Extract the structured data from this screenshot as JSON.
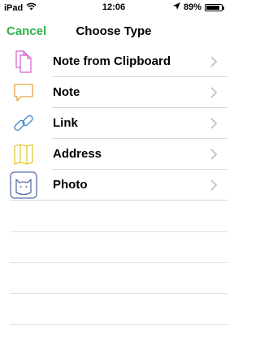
{
  "status": {
    "device": "iPad",
    "time": "12:06",
    "battery": "89%",
    "battery_level": 0.89
  },
  "nav": {
    "cancel_label": "Cancel",
    "title": "Choose Type"
  },
  "items": [
    {
      "label": "Note from Clipboard",
      "icon": "clipboard-note-icon",
      "color": "#d65fd2"
    },
    {
      "label": "Note",
      "icon": "speech-bubble-icon",
      "color": "#e8a33b"
    },
    {
      "label": "Link",
      "icon": "chain-link-icon",
      "color": "#3f86c9"
    },
    {
      "label": "Address",
      "icon": "map-icon",
      "color": "#e6c835"
    },
    {
      "label": "Photo",
      "icon": "cat-photo-icon",
      "color": "#5b6ea8"
    }
  ],
  "colors": {
    "accent": "#2db34a",
    "separator": "#d9d9dc",
    "chevron": "#c7c7cc"
  }
}
